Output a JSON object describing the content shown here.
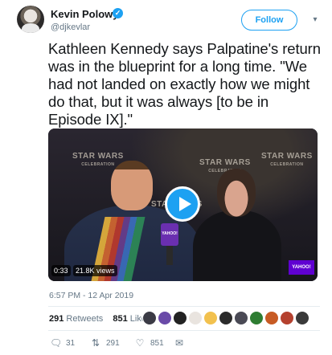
{
  "author": {
    "name": "Kevin Polowy",
    "handle": "@djkevlar",
    "verified_mark": "✓"
  },
  "header": {
    "follow_label": "Follow",
    "caret_icon": "chevron-down-icon"
  },
  "tweet": {
    "text": "Kathleen Kennedy says Palpatine's return was in the blueprint for a long time. \"We had not landed on exactly how we might do that, but it was always [to be in Episode IX].\"",
    "timestamp": "6:57 PM - 12 Apr 2019"
  },
  "video": {
    "duration": "0:33",
    "views": "21.8K views",
    "backdrop_logo": "STAR WARS",
    "backdrop_logo_sub": "CELEBRATION",
    "mic_brand": "YAHOO!",
    "corner_brand": "YAHOO!"
  },
  "stats": {
    "retweets_count": "291",
    "retweets_label": "Retweets",
    "likes_count": "851",
    "likes_label": "Likes",
    "liker_colors": [
      "#3b3b45",
      "#6a4aa8",
      "#222222",
      "#e9e4df",
      "#f2c14e",
      "#2b2b2b",
      "#4a4a55",
      "#2e7d32",
      "#c75b24",
      "#b5412f",
      "#3a3a3a"
    ]
  },
  "actions": {
    "reply_count": "31",
    "retweet_count": "291",
    "like_count": "851",
    "reply_icon": "reply-icon",
    "retweet_icon": "retweet-icon",
    "like_icon": "heart-icon",
    "message_icon": "envelope-icon"
  },
  "colors": {
    "accent": "#1da1f2",
    "text": "#14171a",
    "secondary": "#657786"
  }
}
